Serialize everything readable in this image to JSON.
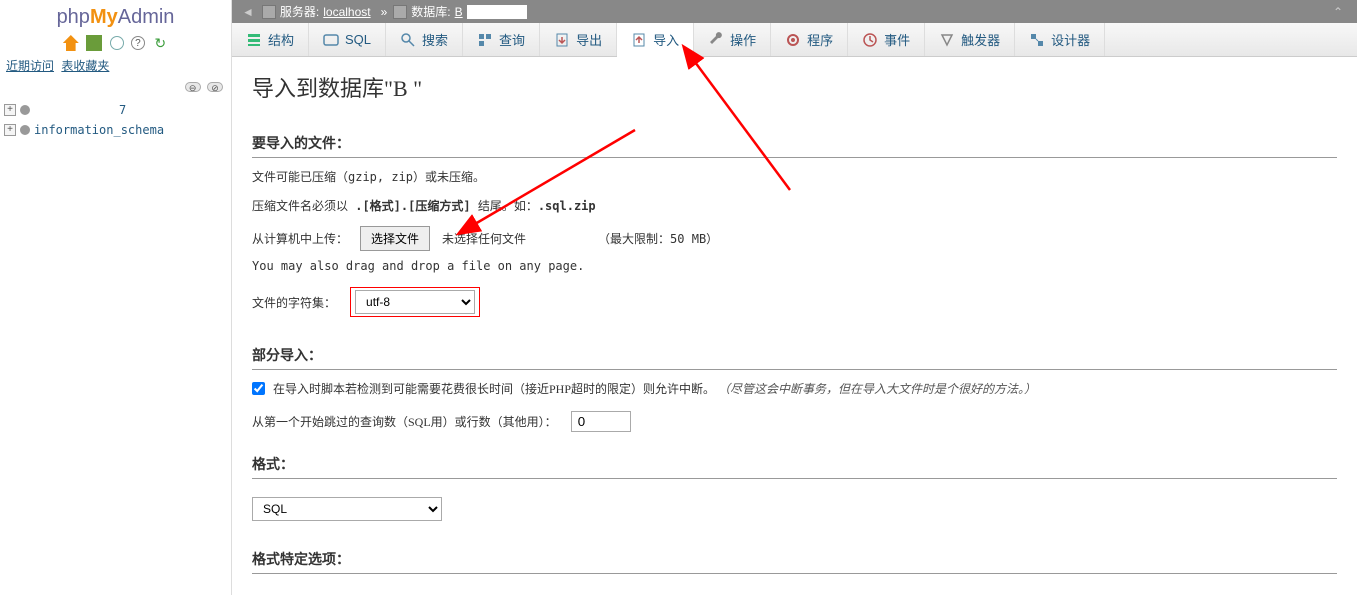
{
  "logo": {
    "php": "php",
    "my": "My",
    "admin": "Admin"
  },
  "sidebar_links": {
    "recent": "近期访问",
    "favorites": "表收藏夹"
  },
  "tree": [
    {
      "label": "7"
    },
    {
      "label": "information_schema"
    }
  ],
  "breadcrumb": {
    "server_label": "服务器:",
    "server_value": "localhost",
    "db_label": "数据库:",
    "db_value_prefix": "B"
  },
  "tabs": [
    {
      "label": "结构",
      "icon": "structure"
    },
    {
      "label": "SQL",
      "icon": "sql"
    },
    {
      "label": "搜索",
      "icon": "search"
    },
    {
      "label": "查询",
      "icon": "query"
    },
    {
      "label": "导出",
      "icon": "export"
    },
    {
      "label": "导入",
      "icon": "import",
      "active": true
    },
    {
      "label": "操作",
      "icon": "operations"
    },
    {
      "label": "程序",
      "icon": "routines"
    },
    {
      "label": "事件",
      "icon": "events"
    },
    {
      "label": "触发器",
      "icon": "triggers"
    },
    {
      "label": "设计器",
      "icon": "designer"
    }
  ],
  "heading": "导入到数据库\"B                \"",
  "section_file": "要导入的文件：",
  "help1": "文件可能已压缩（gzip, zip）或未压缩。",
  "help2_prefix": "压缩文件名必须以 ",
  "help2_bold": ".[格式].[压缩方式]",
  "help2_suffix": " 结尾。如：",
  "help2_example": ".sql.zip",
  "upload_label": "从计算机中上传：",
  "file_button": "选择文件",
  "no_file": "未选择任何文件",
  "max_size": "（最大限制：50 MB）",
  "drag_note": "You may also drag and drop a file on any page.",
  "charset_label": "文件的字符集：",
  "charset_value": "utf-8",
  "section_partial": "部分导入：",
  "partial_check_label": "在导入时脚本若检测到可能需要花费很长时间（接近PHP超时的限定）则允许中断。",
  "partial_check_note": "（尽管这会中断事务，但在导入大文件时是个很好的方法。）",
  "skip_label": "从第一个开始跳过的查询数（SQL用）或行数（其他用）：",
  "skip_value": "0",
  "section_format": "格式：",
  "format_value": "SQL",
  "section_format_options": "格式特定选项："
}
